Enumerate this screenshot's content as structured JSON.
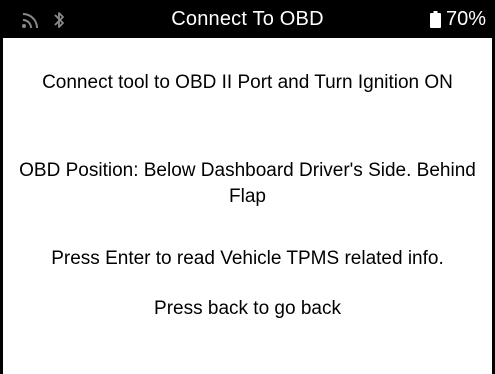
{
  "header": {
    "title": "Connect To OBD",
    "battery_level": "70%",
    "icons": [
      "signal-icon",
      "bluetooth-icon",
      "battery-icon"
    ]
  },
  "messages": {
    "connect": "Connect tool to OBD II Port and Turn Ignition ON",
    "position": "OBD Position: Below Dashboard Driver's Side. Behind Flap",
    "enter": "Press Enter to read Vehicle TPMS related info.",
    "back": "Press back to go back"
  },
  "colors": {
    "header_background": "#000000",
    "header_text": "#ffffff",
    "body_background": "#ffffff",
    "body_text": "#000000"
  }
}
